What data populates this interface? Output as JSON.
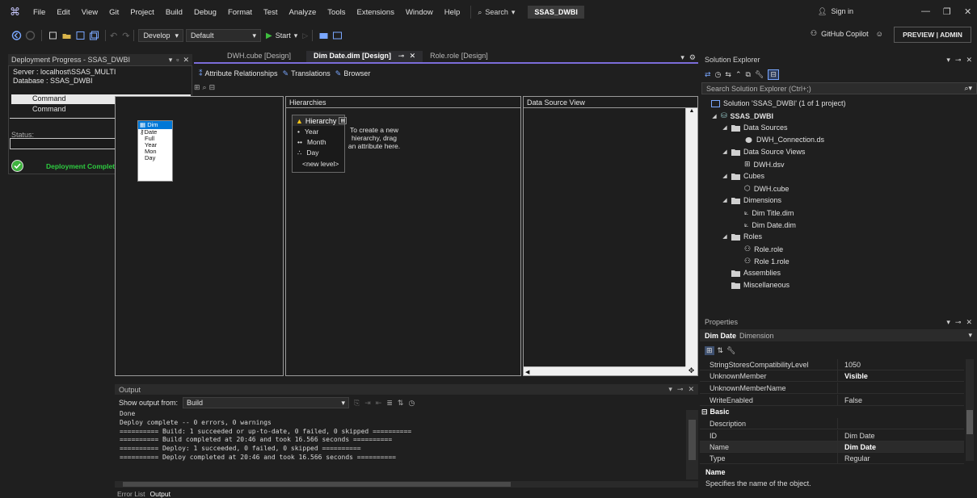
{
  "menu": [
    "File",
    "Edit",
    "View",
    "Git",
    "Project",
    "Build",
    "Debug",
    "Format",
    "Test",
    "Analyze",
    "Tools",
    "Extensions",
    "Window",
    "Help"
  ],
  "search_label": "Search",
  "solution_badge": "SSAS_DWBI",
  "sign_in": "Sign in",
  "toolbar": {
    "config": "Develop",
    "platform": "Default",
    "start": "Start"
  },
  "copilot": "GitHub Copilot",
  "preview_admin": "PREVIEW | ADMIN",
  "deploy": {
    "title": "Deployment Progress - SSAS_DWBI",
    "server": "Server : localhost\\SSAS_MULTI",
    "database": "Database : SSAS_DWBI",
    "commands": [
      "Command",
      "Command"
    ],
    "status_label": "Status:",
    "message": "Deployment Completed Successfully"
  },
  "doc_tabs": [
    "DWH.cube [Design]",
    "Dim Date.dim [Design]",
    "Role.role [Design]"
  ],
  "designer_tabs": [
    "Attribute Relationships",
    "Translations",
    "Browser"
  ],
  "panes": {
    "hierarchies": "Hierarchies",
    "dsv": "Data Source View"
  },
  "hierarchy": {
    "title": "Hierarchy",
    "levels": [
      {
        "bullet": "•",
        "name": "Year"
      },
      {
        "bullet": "••",
        "name": "Month"
      },
      {
        "bullet": "∴",
        "name": "Day"
      }
    ],
    "new_level": "<new level>",
    "hint": "To create a new hierarchy, drag an attribute here."
  },
  "dsv_table": {
    "header": "Dim",
    "rows": [
      "Date",
      "Full",
      "Year",
      "Mon",
      "Day"
    ]
  },
  "output": {
    "title": "Output",
    "show_from_label": "Show output from:",
    "source": "Build",
    "lines": [
      "Done",
      "Deploy complete -- 0 errors, 0 warnings",
      "========== Build: 1 succeeded or up-to-date, 0 failed, 0 skipped ==========",
      "========== Build completed at 20:46 and took 16.566 seconds ==========",
      "========== Deploy: 1 succeeded, 0 failed, 0 skipped ==========",
      "========== Deploy completed at 20:46 and took 16.566 seconds =========="
    ],
    "tabs": [
      "Error List",
      "Output"
    ]
  },
  "solution_explorer": {
    "title": "Solution Explorer",
    "search_placeholder": "Search Solution Explorer (Ctrl+;)",
    "solution": "Solution 'SSAS_DWBI' (1 of 1 project)",
    "project": "SSAS_DWBI",
    "folders": {
      "data_sources": "Data Sources",
      "dwh_connection": "DWH_Connection.ds",
      "data_source_views": "Data Source Views",
      "dwh_dsv": "DWH.dsv",
      "cubes": "Cubes",
      "dwh_cube": "DWH.cube",
      "dimensions": "Dimensions",
      "dim_title": "Dim Title.dim",
      "dim_date": "Dim Date.dim",
      "roles": "Roles",
      "role": "Role.role",
      "role1": "Role 1.role",
      "assemblies": "Assemblies",
      "misc": "Miscellaneous"
    }
  },
  "properties": {
    "title": "Properties",
    "object_name": "Dim Date",
    "object_type": "Dimension",
    "rows": [
      {
        "name": "StringStoresCompatibilityLevel",
        "value": "1050"
      },
      {
        "name": "UnknownMember",
        "value": "Visible"
      },
      {
        "name": "UnknownMemberName",
        "value": ""
      },
      {
        "name": "WriteEnabled",
        "value": "False"
      }
    ],
    "category": "Basic",
    "basic_rows": [
      {
        "name": "Description",
        "value": ""
      },
      {
        "name": "ID",
        "value": "Dim Date"
      },
      {
        "name": "Name",
        "value": "Dim Date"
      },
      {
        "name": "Type",
        "value": "Regular"
      }
    ],
    "desc_title": "Name",
    "desc_text": "Specifies the name of the object."
  }
}
